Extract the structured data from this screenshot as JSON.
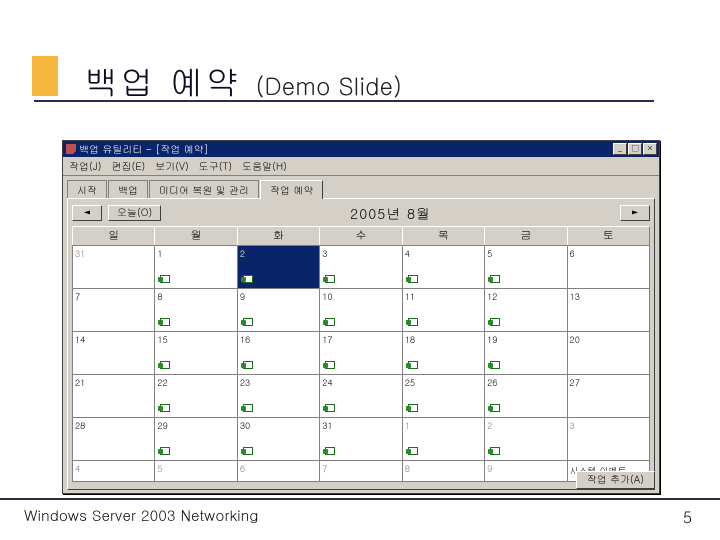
{
  "slide": {
    "title_main": "백업 예약",
    "title_sub": "(Demo Slide)",
    "footer_left": "Windows  Server 2003 Networking",
    "footer_right": "5"
  },
  "window": {
    "title": "백업 유틸리티 - [작업 예약]",
    "sys_buttons": {
      "min": "_",
      "max": "□",
      "close": "×"
    },
    "menu": [
      "작업(J)",
      "편집(E)",
      "보기(V)",
      "도구(T)",
      "도움말(H)"
    ],
    "tabs": [
      "시작",
      "백업",
      "미디어 복원 및 관리",
      "작업 예약"
    ],
    "active_tab": 3,
    "nav": {
      "prev": "◄",
      "today": "오늘(O)",
      "next": "►"
    },
    "month_label": "2005년 8월",
    "day_headers": [
      "일",
      "월",
      "화",
      "수",
      "목",
      "금",
      "토"
    ],
    "weeks": [
      [
        {
          "n": "31",
          "gray": true
        },
        {
          "n": "1",
          "job": true
        },
        {
          "n": "2",
          "job": true,
          "sel": true
        },
        {
          "n": "3",
          "job": true
        },
        {
          "n": "4",
          "job": true
        },
        {
          "n": "5",
          "job": true
        },
        {
          "n": "6"
        }
      ],
      [
        {
          "n": "7"
        },
        {
          "n": "8",
          "job": true
        },
        {
          "n": "9",
          "job": true
        },
        {
          "n": "10",
          "job": true
        },
        {
          "n": "11",
          "job": true
        },
        {
          "n": "12",
          "job": true
        },
        {
          "n": "13"
        }
      ],
      [
        {
          "n": "14"
        },
        {
          "n": "15",
          "job": true
        },
        {
          "n": "16",
          "job": true
        },
        {
          "n": "17",
          "job": true
        },
        {
          "n": "18",
          "job": true
        },
        {
          "n": "19",
          "job": true
        },
        {
          "n": "20"
        }
      ],
      [
        {
          "n": "21"
        },
        {
          "n": "22",
          "job": true
        },
        {
          "n": "23",
          "job": true
        },
        {
          "n": "24",
          "job": true
        },
        {
          "n": "25",
          "job": true
        },
        {
          "n": "26",
          "job": true
        },
        {
          "n": "27"
        }
      ],
      [
        {
          "n": "28"
        },
        {
          "n": "29",
          "job": true
        },
        {
          "n": "30",
          "job": true
        },
        {
          "n": "31",
          "job": true
        },
        {
          "n": "1",
          "gray": true,
          "job": true
        },
        {
          "n": "2",
          "gray": true,
          "job": true
        },
        {
          "n": "3",
          "gray": true
        }
      ],
      [
        {
          "n": "4",
          "gray": true
        },
        {
          "n": "5",
          "gray": true
        },
        {
          "n": "6",
          "gray": true
        },
        {
          "n": "7",
          "gray": true
        },
        {
          "n": "8",
          "gray": true
        },
        {
          "n": "9",
          "gray": true
        },
        {
          "sys": "시스템 이벤트"
        }
      ]
    ],
    "add_button": "작업 추가(A)"
  }
}
